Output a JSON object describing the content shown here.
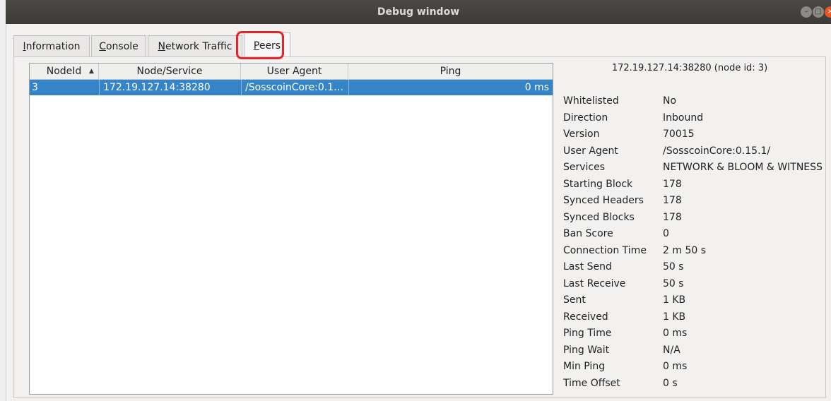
{
  "window": {
    "title": "Debug window",
    "minimize_symbol": "–",
    "maximize_symbol": "□",
    "close_symbol": "×"
  },
  "tabs": [
    {
      "label": "Information",
      "accel": "I",
      "rest": "nformation",
      "active": false
    },
    {
      "label": "Console",
      "accel": "C",
      "rest": "onsole",
      "active": false
    },
    {
      "label": "Network Traffic",
      "accel": "N",
      "rest": "etwork Traffic",
      "active": false
    },
    {
      "label": "Peers",
      "accel": "P",
      "rest": "eers",
      "active": true
    }
  ],
  "peers_table": {
    "columns": [
      "NodeId",
      "Node/Service",
      "User Agent",
      "Ping"
    ],
    "sort_indicator": "▲",
    "rows": [
      {
        "node_id": "3",
        "node_service": "172.19.127.14:38280",
        "user_agent": "/SosscoinCore:0.1…",
        "ping": "0 ms",
        "selected": true
      }
    ]
  },
  "peer_details": {
    "header": "172.19.127.14:38280 (node id: 3)",
    "fields": [
      {
        "label": "Whitelisted",
        "value": "No"
      },
      {
        "label": "Direction",
        "value": "Inbound"
      },
      {
        "label": "Version",
        "value": "70015"
      },
      {
        "label": "User Agent",
        "value": "/SosscoinCore:0.15.1/"
      },
      {
        "label": "Services",
        "value": "NETWORK & BLOOM & WITNESS"
      },
      {
        "label": "Starting Block",
        "value": "178"
      },
      {
        "label": "Synced Headers",
        "value": "178"
      },
      {
        "label": "Synced Blocks",
        "value": "178"
      },
      {
        "label": "Ban Score",
        "value": "0"
      },
      {
        "label": "Connection Time",
        "value": "2 m 50 s"
      },
      {
        "label": "Last Send",
        "value": "50 s"
      },
      {
        "label": "Last Receive",
        "value": "50 s"
      },
      {
        "label": "Sent",
        "value": "1 KB"
      },
      {
        "label": "Received",
        "value": "1 KB"
      },
      {
        "label": "Ping Time",
        "value": "0 ms"
      },
      {
        "label": "Ping Wait",
        "value": "N/A"
      },
      {
        "label": "Min Ping",
        "value": "0 ms"
      },
      {
        "label": "Time Offset",
        "value": "0 s"
      }
    ]
  },
  "colors": {
    "selection": "#3584c7",
    "highlight_box": "#e3262b",
    "close_button": "#e95420",
    "titlebar": "#3b3a37"
  }
}
